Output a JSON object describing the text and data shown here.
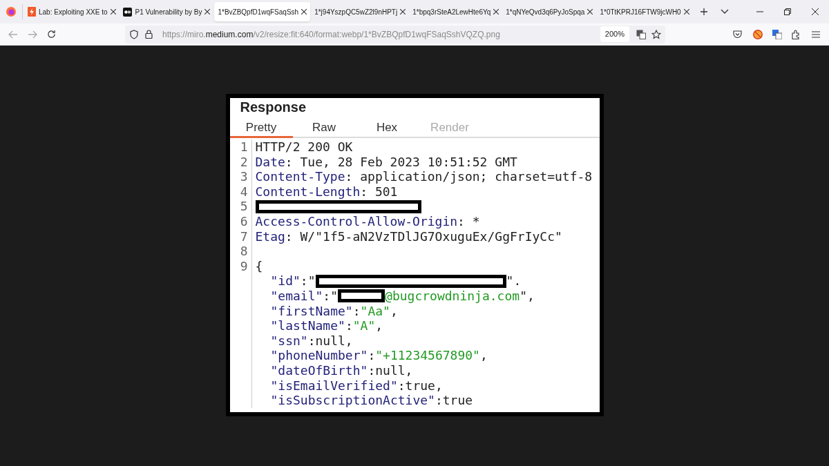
{
  "browser": {
    "tabs": [
      {
        "title": "Lab: Exploiting XXE to",
        "selected": false
      },
      {
        "title": "P1 Vulnerability by By",
        "selected": false
      },
      {
        "title": "1*BvZBQpfD1wqFSaqSsh",
        "selected": true
      },
      {
        "title": "1*j94YszpQC5wZ2l9nHPTj",
        "selected": false
      },
      {
        "title": "1*bpq3rSteA2LewHte6Yq",
        "selected": false
      },
      {
        "title": "1*qNYeQvd3q6PyJoSpqa",
        "selected": false
      },
      {
        "title": "1*0TtKPRJ16FTW9jcWH0",
        "selected": false
      }
    ],
    "address": "https://miro.**medium.com**/v2/resize:fit:640/format:webp/1*BvZBQpfD1wqFSaqSshVQZQ.png",
    "zoom": "200%"
  },
  "response": {
    "title": "Response",
    "tabs": [
      {
        "label": "Pretty",
        "selected": true,
        "disabled": false
      },
      {
        "label": "Raw",
        "selected": false,
        "disabled": false
      },
      {
        "label": "Hex",
        "selected": false,
        "disabled": false
      },
      {
        "label": "Render",
        "selected": false,
        "disabled": true
      }
    ],
    "lines": [
      {
        "number": "1",
        "segments": [
          {
            "kind": "plain",
            "text": "HTTP/2 200 OK"
          }
        ]
      },
      {
        "number": "2",
        "segments": [
          {
            "kind": "key",
            "text": "Date"
          },
          {
            "kind": "plain",
            "text": ": Tue, 28 Feb 2023 10:51:52 GMT"
          }
        ]
      },
      {
        "number": "3",
        "segments": [
          {
            "kind": "key",
            "text": "Content-Type"
          },
          {
            "kind": "plain",
            "text": ": application/json; charset=utf-8"
          }
        ]
      },
      {
        "number": "4",
        "segments": [
          {
            "kind": "key",
            "text": "Content-Length"
          },
          {
            "kind": "plain",
            "text": ": 501"
          }
        ]
      },
      {
        "number": "5",
        "segments": [
          {
            "kind": "redaction"
          }
        ]
      },
      {
        "number": "6",
        "segments": [
          {
            "kind": "key",
            "text": "Access-Control-Allow-Origin"
          },
          {
            "kind": "plain",
            "text": ": *"
          }
        ]
      },
      {
        "number": "7",
        "segments": [
          {
            "kind": "key",
            "text": "Etag"
          },
          {
            "kind": "plain",
            "text": ": W/\"1f5-aN2VzTDlJG7OxuguEx/GgFrIyCc\""
          }
        ]
      },
      {
        "number": "8"
      },
      {
        "number": "9",
        "segments": [
          {
            "kind": "plain",
            "text": "{"
          }
        ],
        "children": [
          {
            "segments": [
              {
                "kind": "key",
                "text": "\"id\""
              },
              {
                "kind": "plain",
                "text": ":\""
              },
              {
                "kind": "redaction"
              },
              {
                "kind": "plain",
                "text": "\"."
              }
            ]
          },
          {
            "segments": [
              {
                "kind": "key",
                "text": "\"email\""
              },
              {
                "kind": "plain",
                "text": ":\""
              },
              {
                "kind": "redaction"
              },
              {
                "kind": "string",
                "text": "@bugcrowdninja.com"
              },
              {
                "kind": "plain",
                "text": "\","
              }
            ]
          },
          {
            "segments": [
              {
                "kind": "key",
                "text": "\"firstName\""
              },
              {
                "kind": "plain",
                "text": ":"
              },
              {
                "kind": "string",
                "text": "\"Aa\""
              },
              {
                "kind": "plain",
                "text": ","
              }
            ]
          },
          {
            "segments": [
              {
                "kind": "key",
                "text": "\"lastName\""
              },
              {
                "kind": "plain",
                "text": ":"
              },
              {
                "kind": "string",
                "text": "\"A\""
              },
              {
                "kind": "plain",
                "text": ","
              }
            ]
          },
          {
            "segments": [
              {
                "kind": "key",
                "text": "\"ssn\""
              },
              {
                "kind": "plain",
                "text": ":null,"
              }
            ]
          },
          {
            "segments": [
              {
                "kind": "key",
                "text": "\"phoneNumber\""
              },
              {
                "kind": "plain",
                "text": ":"
              },
              {
                "kind": "string",
                "text": "\"+11234567890\""
              },
              {
                "kind": "plain",
                "text": ","
              }
            ]
          },
          {
            "segments": [
              {
                "kind": "key",
                "text": "\"dateOfBirth\""
              },
              {
                "kind": "plain",
                "text": ":null,"
              }
            ]
          },
          {
            "segments": [
              {
                "kind": "key",
                "text": "\"isEmailVerified\""
              },
              {
                "kind": "plain",
                "text": ":true,"
              }
            ]
          },
          {
            "segments": [
              {
                "kind": "key",
                "text": "\"isSubscriptionActive\""
              },
              {
                "kind": "plain",
                "text": ":true"
              }
            ]
          }
        ]
      }
    ]
  }
}
